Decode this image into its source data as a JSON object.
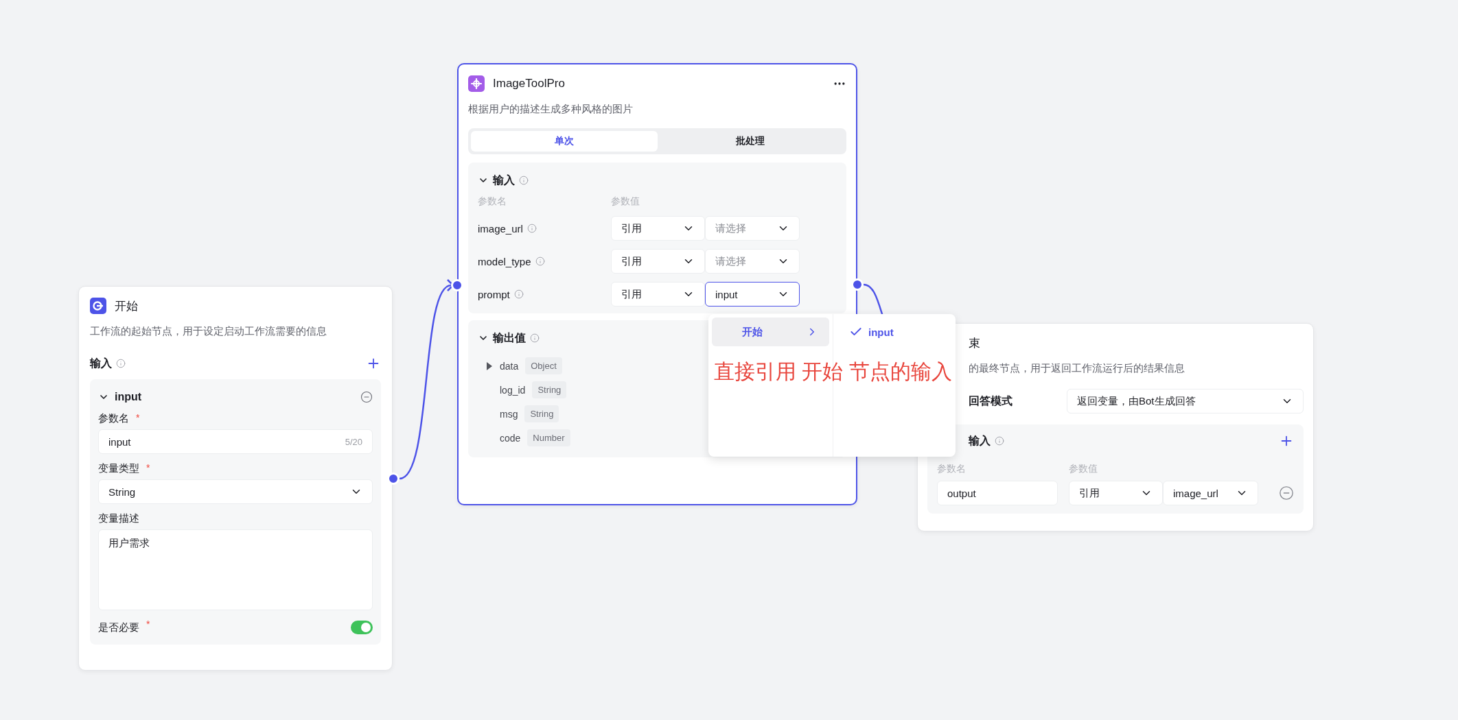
{
  "start_node": {
    "title": "开始",
    "description": "工作流的起始节点，用于设定启动工作流需要的信息",
    "section_title": "输入",
    "variable": {
      "name": "input",
      "expanded": true,
      "name_label": "参数名",
      "name_required": "*",
      "name_value": "input",
      "name_count": "5/20",
      "type_label": "变量类型",
      "type_required": "*",
      "type_value": "String",
      "desc_label": "变量描述",
      "desc_value": "用户需求",
      "required_label": "是否必要",
      "required_mark": "*",
      "required": true
    }
  },
  "tool_node": {
    "title": "ImageToolPro",
    "description": "根据用户的描述生成多种风格的图片",
    "tabs": [
      {
        "label": "单次",
        "selected": true
      },
      {
        "label": "批处理",
        "selected": false
      }
    ],
    "inputs": {
      "title": "输入",
      "expanded": true,
      "headers": [
        "参数名",
        "参数值"
      ],
      "rows": [
        {
          "name": "image_url",
          "source": "引用",
          "placeholder": "请选择",
          "focused": false
        },
        {
          "name": "model_type",
          "source": "引用",
          "placeholder": "请选择",
          "focused": false
        },
        {
          "name": "prompt",
          "source": "引用",
          "value": "input",
          "focused": true
        }
      ]
    },
    "outputs": {
      "title": "输出值",
      "expanded": true,
      "items": [
        {
          "name": "data",
          "type": "Object",
          "has_children": true
        },
        {
          "name": "log_id",
          "type": "String",
          "has_children": false
        },
        {
          "name": "msg",
          "type": "String",
          "has_children": false
        },
        {
          "name": "code",
          "type": "Number",
          "has_children": false
        }
      ]
    }
  },
  "reference_menu": {
    "nodes": [
      {
        "label": "开始",
        "selected": true
      }
    ],
    "variables": [
      {
        "label": "input",
        "selected": true
      }
    ]
  },
  "annotation": {
    "text": "直接引用 开始 节点的输入"
  },
  "end_node": {
    "title": "束",
    "description": "的最终节点，用于返回工作流运行后的结果信息",
    "mode_label": "回答模式",
    "mode_value": "返回变量，由Bot生成回答",
    "inputs": {
      "title": "输入",
      "headers": [
        "参数名",
        "参数值"
      ],
      "rows": [
        {
          "name": "output",
          "source": "引用",
          "value": "image_url"
        }
      ]
    }
  }
}
